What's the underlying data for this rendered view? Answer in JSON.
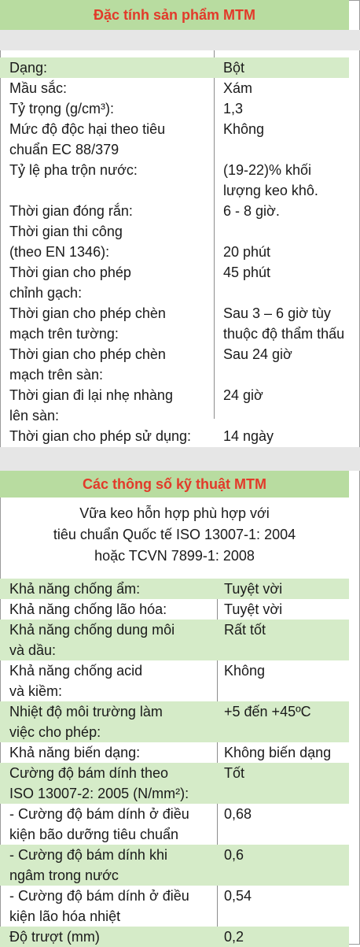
{
  "section1": {
    "title": "Đặc tính sản phẩm MTM",
    "rows": [
      {
        "label": [
          "Dạng:"
        ],
        "value": [
          "Bột"
        ]
      },
      {
        "label": [
          "Mầu sắc:"
        ],
        "value": [
          "Xám"
        ]
      },
      {
        "label": [
          "Tỷ trọng (g/cm³):"
        ],
        "value": [
          "1,3"
        ]
      },
      {
        "label": [
          "Mức độ độc hại theo tiêu",
          "chuẩn EC 88/379"
        ],
        "value": [
          "Không"
        ]
      },
      {
        "label": [
          "Tỷ lệ pha trộn nước:"
        ],
        "value": [
          "(19-22)% khối",
          "lượng keo khô."
        ]
      },
      {
        "label": [
          "Thời gian đóng rắn:"
        ],
        "value": [
          "6 - 8 giờ."
        ]
      },
      {
        "label": [
          "Thời gian thi công",
          "(theo EN 1346):"
        ],
        "value": [
          "",
          "20 phút"
        ]
      },
      {
        "label": [
          "Thời gian cho phép",
          "chỉnh gạch:"
        ],
        "value": [
          "45 phút"
        ]
      },
      {
        "label": [
          "Thời gian cho phép chèn",
          "mạch trên tường:"
        ],
        "value": [
          "Sau 3 – 6 giờ tùy",
          "thuộc độ thẩm thấu"
        ]
      },
      {
        "label": [
          "Thời gian cho phép chèn",
          "mạch trên sàn:"
        ],
        "value": [
          "Sau 24 giờ"
        ]
      },
      {
        "label": [
          "Thời gian đi lại nhẹ nhàng",
          "lên sàn:"
        ],
        "value": [
          "24 giờ"
        ]
      },
      {
        "label": [
          "Thời gian cho phép sử dụng:"
        ],
        "value": [
          "14 ngày"
        ]
      }
    ]
  },
  "section2": {
    "title": "Các thông số kỹ thuật MTM",
    "note": [
      "Vữa keo hỗn hợp phù hợp với",
      "tiêu chuẩn Quốc tế ISO 13007-1: 2004",
      "hoặc TCVN 7899-1: 2008"
    ],
    "rows": [
      {
        "label": [
          "Khả năng chống ẩm:"
        ],
        "value": [
          "Tuyệt vời"
        ]
      },
      {
        "label": [
          "Khả năng chống lão hóa:"
        ],
        "value": [
          "Tuyệt vời"
        ]
      },
      {
        "label": [
          "Khả năng chống dung môi",
          "và dầu:"
        ],
        "value": [
          "Rất tốt"
        ]
      },
      {
        "label": [
          "Khả năng chống acid",
          "và kiềm:"
        ],
        "value": [
          "Không"
        ]
      },
      {
        "label": [
          "Nhiệt độ môi trường làm",
          "việc cho phép:"
        ],
        "value": [
          "+5 đến +45ºC"
        ]
      },
      {
        "label": [
          "Khả năng biến dạng:"
        ],
        "value": [
          "Không biến dạng"
        ]
      },
      {
        "label": [
          "Cường độ bám dính theo",
          "ISO 13007-2: 2005 (N/mm²):"
        ],
        "value": [
          "Tốt"
        ]
      },
      {
        "label": [
          "- Cường độ bám dính ở điều",
          "kiện bão dưỡng tiêu chuẩn"
        ],
        "value": [
          "0,68"
        ]
      },
      {
        "label": [
          "- Cường độ bám dính khi",
          "ngâm trong nước"
        ],
        "value": [
          "0,6"
        ]
      },
      {
        "label": [
          "- Cường độ bám dính ở điều",
          "kiện lão hóa nhiệt"
        ],
        "value": [
          "0,54"
        ]
      },
      {
        "label": [
          "Độ trượt (mm)"
        ],
        "value": [
          "0,2"
        ]
      }
    ]
  },
  "colors": {
    "header_bg": "#b8dca0",
    "title_red": "#e23a2a",
    "band_bg": "#d5ebc8",
    "gap_bg": "#e6e6e6"
  }
}
